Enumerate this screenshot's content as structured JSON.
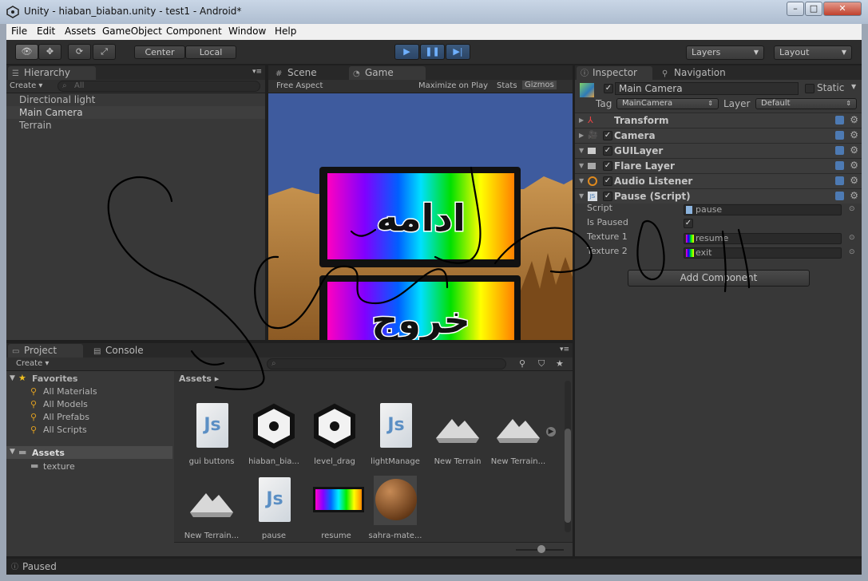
{
  "window": {
    "title": "Unity - hiaban_biaban.unity - test1 - Android*"
  },
  "menu": [
    "File",
    "Edit",
    "Assets",
    "GameObject",
    "Component",
    "Window",
    "Help"
  ],
  "toolbar": {
    "center_label": "Center",
    "local_label": "Local",
    "layers_label": "Layers",
    "layout_label": "Layout"
  },
  "hierarchy": {
    "tab": "Hierarchy",
    "create": "Create",
    "search_placeholder": "All",
    "items": [
      "Directional light",
      "Main Camera",
      "Terrain"
    ]
  },
  "scene": {
    "scene_tab": "Scene",
    "game_tab": "Game",
    "aspect": "Free Aspect",
    "maximize": "Maximize on Play",
    "stats": "Stats",
    "gizmos": "Gizmos",
    "button1_text": "ادامه",
    "button2_text": "خروج"
  },
  "inspector": {
    "tab": "Inspector",
    "nav_tab": "Navigation",
    "object_name": "Main Camera",
    "static_label": "Static",
    "tag_label": "Tag",
    "tag_value": "MainCamera",
    "layer_label": "Layer",
    "layer_value": "Default",
    "components": [
      "Transform",
      "Camera",
      "GUILayer",
      "Flare Layer",
      "Audio Listener",
      "Pause (Script)"
    ],
    "script_label": "Script",
    "script_value": "pause",
    "paused_label": "Is Paused",
    "tex1_label": "Texture 1",
    "tex1_value": "resume",
    "tex2_label": "Texture 2",
    "tex2_value": "exit",
    "add_component": "Add Component"
  },
  "project": {
    "tab": "Project",
    "console_tab": "Console",
    "create": "Create",
    "favorites_label": "Favorites",
    "favorites": [
      "All Materials",
      "All Models",
      "All Prefabs",
      "All Scripts"
    ],
    "assets_label": "Assets",
    "folder": "texture",
    "breadcrumb": "Assets",
    "assets": [
      "gui buttons",
      "hiaban_bia...",
      "level_drag",
      "lightManage",
      "New Terrain",
      "New Terrain...",
      "New Terrain...",
      "pause",
      "resume",
      "sahra-mate..."
    ]
  },
  "status": {
    "text": "Paused"
  },
  "colors": {
    "accent": "#3b5a7e",
    "panel": "#383838",
    "sky": "#3e5b9e",
    "sand": "#b8823e"
  }
}
